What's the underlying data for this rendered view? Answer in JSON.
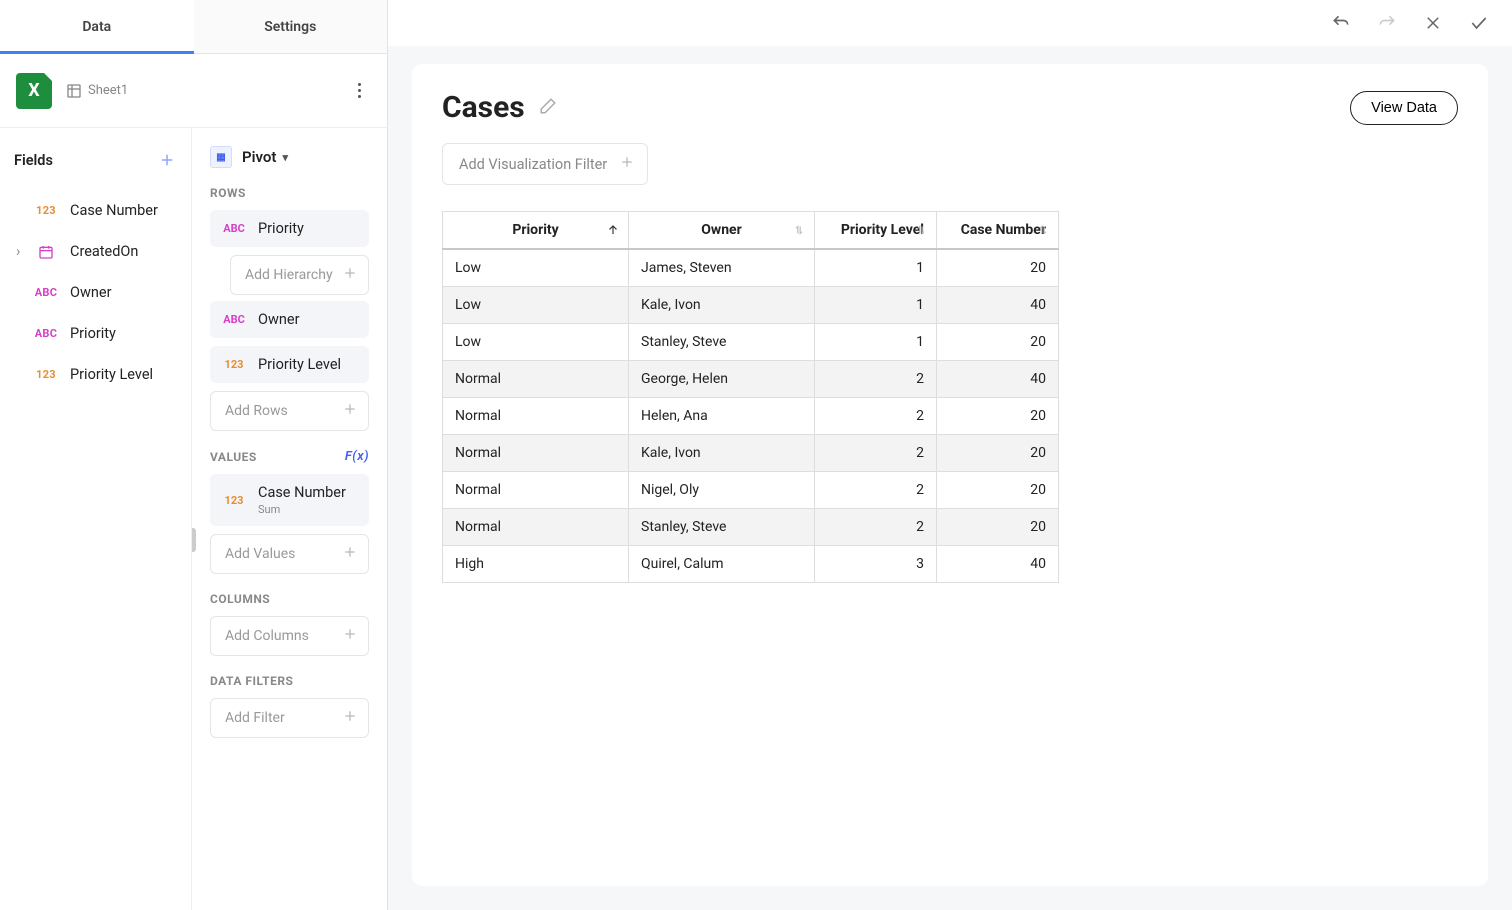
{
  "tabs": {
    "data": "Data",
    "settings": "Settings"
  },
  "source": {
    "sheet": "Sheet1"
  },
  "fieldsPanel": {
    "title": "Fields",
    "items": [
      {
        "type": "num",
        "label": "Case Number"
      },
      {
        "type": "date",
        "label": "CreatedOn",
        "expandable": true
      },
      {
        "type": "txt",
        "label": "Owner"
      },
      {
        "type": "txt",
        "label": "Priority"
      },
      {
        "type": "num",
        "label": "Priority Level"
      }
    ]
  },
  "config": {
    "pivotLabel": "Pivot",
    "sections": {
      "rows": "ROWS",
      "values": "VALUES",
      "columns": "COLUMNS",
      "dataFilters": "DATA FILTERS"
    },
    "fxLabel": "F(x)",
    "rows": [
      {
        "type": "txt",
        "label": "Priority"
      },
      {
        "type": "txt",
        "label": "Owner"
      },
      {
        "type": "num",
        "label": "Priority Level"
      }
    ],
    "values": [
      {
        "type": "num",
        "label": "Case Number",
        "agg": "Sum"
      }
    ],
    "placeholders": {
      "addHierarchy": "Add Hierarchy",
      "addRows": "Add Rows",
      "addValues": "Add Values",
      "addColumns": "Add Columns",
      "addFilter": "Add Filter"
    }
  },
  "canvas": {
    "title": "Cases",
    "viewData": "View Data",
    "addVizFilter": "Add Visualization Filter"
  },
  "table": {
    "columns": [
      {
        "key": "priority",
        "label": "Priority",
        "numeric": false,
        "sortActive": true
      },
      {
        "key": "owner",
        "label": "Owner",
        "numeric": false,
        "sortActive": false
      },
      {
        "key": "plevel",
        "label": "Priority Level",
        "numeric": true,
        "sortActive": false
      },
      {
        "key": "casenum",
        "label": "Case Number",
        "numeric": true,
        "sortActive": false
      }
    ],
    "rows": [
      {
        "priority": "Low",
        "owner": "James, Steven",
        "plevel": 1,
        "casenum": 20
      },
      {
        "priority": "Low",
        "owner": "Kale, Ivon",
        "plevel": 1,
        "casenum": 40
      },
      {
        "priority": "Low",
        "owner": "Stanley, Steve",
        "plevel": 1,
        "casenum": 20
      },
      {
        "priority": "Normal",
        "owner": "George, Helen",
        "plevel": 2,
        "casenum": 40
      },
      {
        "priority": "Normal",
        "owner": "Helen, Ana",
        "plevel": 2,
        "casenum": 20
      },
      {
        "priority": "Normal",
        "owner": "Kale, Ivon",
        "plevel": 2,
        "casenum": 20
      },
      {
        "priority": "Normal",
        "owner": "Nigel, Oly",
        "plevel": 2,
        "casenum": 20
      },
      {
        "priority": "Normal",
        "owner": "Stanley, Steve",
        "plevel": 2,
        "casenum": 20
      },
      {
        "priority": "High",
        "owner": "Quirel, Calum",
        "plevel": 3,
        "casenum": 40
      }
    ]
  }
}
